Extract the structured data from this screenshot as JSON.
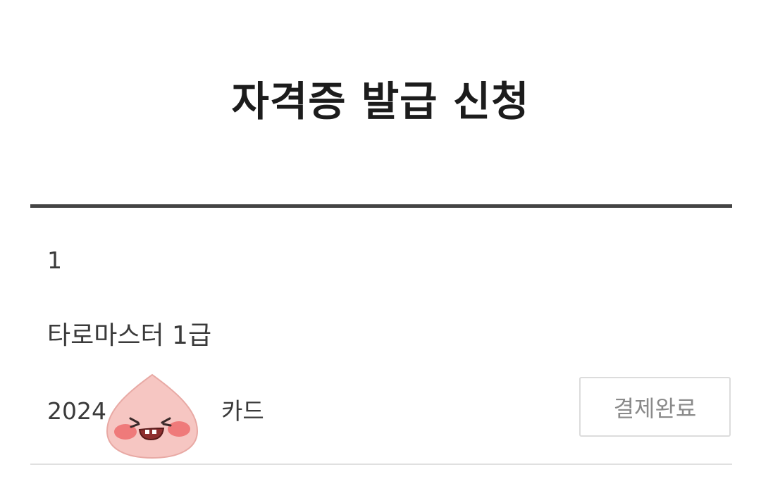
{
  "header": {
    "title": "자격증 발급 신청"
  },
  "order": {
    "number": "1",
    "item_name": "타로마스터 1급",
    "date_visible": "2024",
    "payment_method": "카드",
    "status_label": "결제완료"
  },
  "overlay": {
    "sticker_icon": "peach-face-sticker-icon"
  },
  "colors": {
    "title": "#1c1c1c",
    "text": "#3a3a3a",
    "divider_strong": "#444444",
    "divider_light": "#e0e0e0",
    "button_border": "#dcdcdc",
    "button_text": "#8a8a8a",
    "sticker_body": "#f6c6c2",
    "sticker_cheek": "#ef7a7a"
  }
}
